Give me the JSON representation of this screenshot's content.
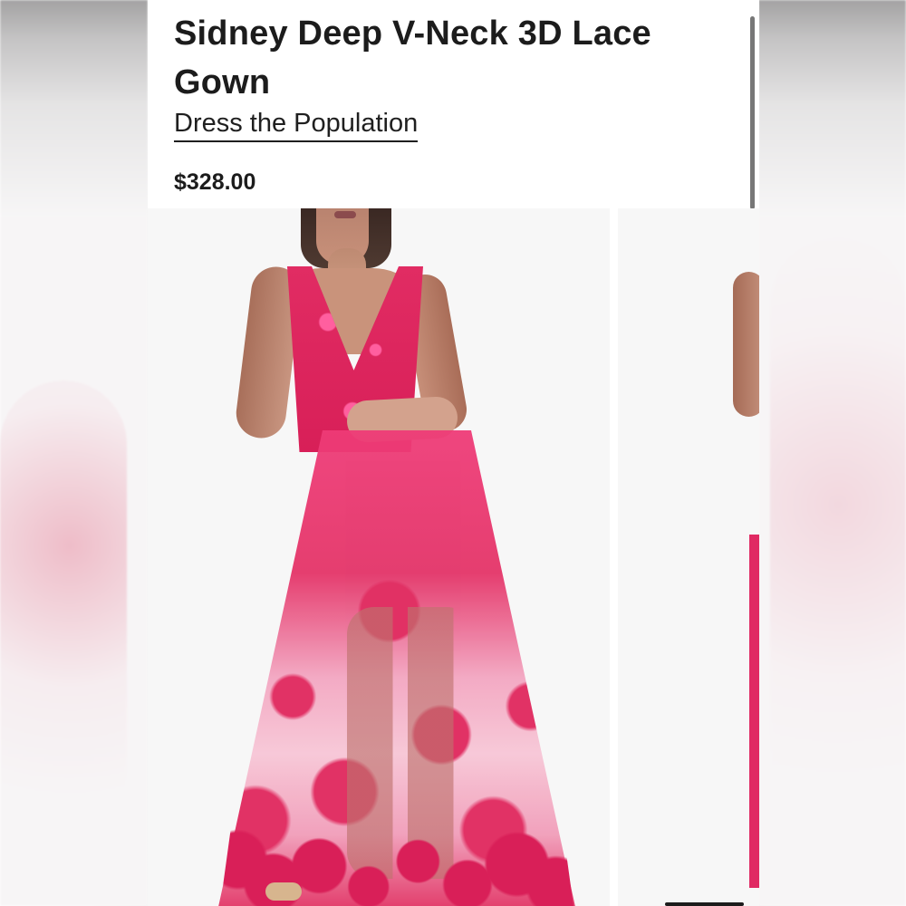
{
  "product": {
    "title": "Sidney Deep V-Neck 3D Lace Gown",
    "brand": "Dress the Population",
    "price": "$328.00"
  },
  "gallery": {
    "main_image": "pink-lace-gown-photo",
    "secondary_image": "pink-lace-gown-side-photo"
  },
  "colors": {
    "dress": "#D81F58",
    "accent": "#EF3C78",
    "background": "#F7F7F7",
    "text": "#1C1C1C"
  }
}
